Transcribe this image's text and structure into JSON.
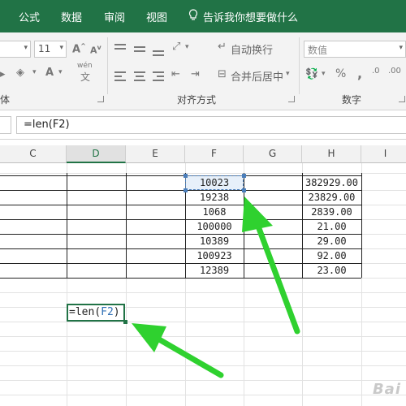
{
  "menu": {
    "tabs": [
      "公式",
      "数据",
      "审阅",
      "视图"
    ],
    "tell_me": "告诉我你想要做什么"
  },
  "ribbon": {
    "font_size": "11",
    "font_group_label": "体",
    "font_size_up": "A",
    "font_size_down": "A",
    "font_color": "A",
    "pinyin": "wén",
    "wrap_text": "自动换行",
    "merge_center": "合并后居中",
    "alignment_label": "对齐方式",
    "number_format": "数值",
    "percent": "%",
    "comma": ",",
    "number_label": "数字"
  },
  "formula_bar": {
    "content": "=len(F2)"
  },
  "columns": [
    "C",
    "D",
    "E",
    "F",
    "G",
    "H",
    "I"
  ],
  "active_column": "D",
  "table": {
    "f_values": [
      "10023",
      "19238",
      "1068",
      "100000",
      "10389",
      "100923",
      "12389"
    ],
    "h_values": [
      "382929.00",
      "23829.00",
      "2839.00",
      "21.00",
      "29.00",
      "92.00",
      "23.00"
    ]
  },
  "edit_cell": {
    "prefix": "=len(",
    "ref": "F2",
    "suffix": ")"
  },
  "watermark": "Bai",
  "colors": {
    "accent": "#217346",
    "arrow": "#2fd12f",
    "reference": "#4a7ebb"
  }
}
